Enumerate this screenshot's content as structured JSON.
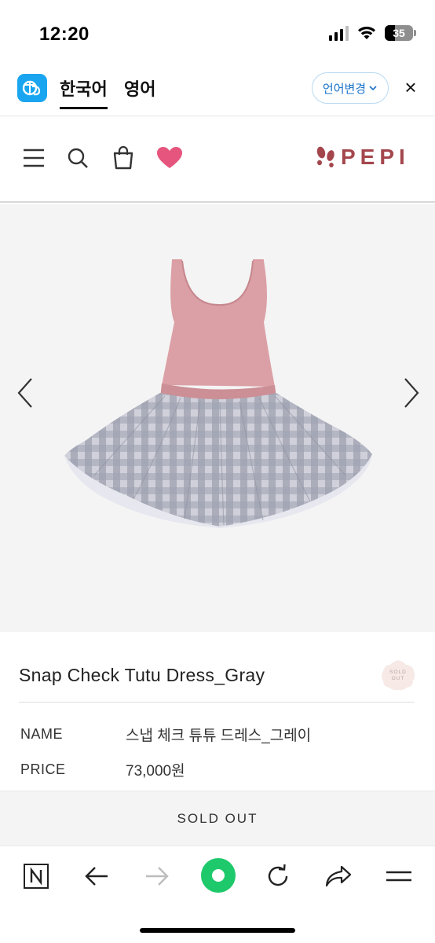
{
  "status": {
    "time": "12:20",
    "battery": "35",
    "battery_level": 0.35
  },
  "translate_bar": {
    "active_lang": "한국어",
    "other_lang": "영어",
    "change_button": "언어변경",
    "close": "×"
  },
  "header": {
    "brand": "PEPI",
    "icons": [
      "menu-icon",
      "search-icon",
      "shopping-bag-icon",
      "heart-icon"
    ]
  },
  "product": {
    "title": "Snap Check Tutu Dress_Gray",
    "badge_text": "SOLD OUT",
    "name_label": "NAME",
    "name_value": "스냅 체크 튜튜 드레스_그레이",
    "price_label": "PRICE",
    "price_value": "73,000원",
    "soldout_button": "SOLD OUT"
  },
  "browser_bar": {
    "icons": [
      "naver-icon",
      "back-icon",
      "forward-icon",
      "home-icon",
      "reload-icon",
      "share-icon",
      "menu-icon"
    ]
  },
  "colors": {
    "brand": "#a4474d",
    "heart": "#e5557e",
    "translate_blue": "#1aa5f0",
    "browser_green": "#1ec96b"
  }
}
